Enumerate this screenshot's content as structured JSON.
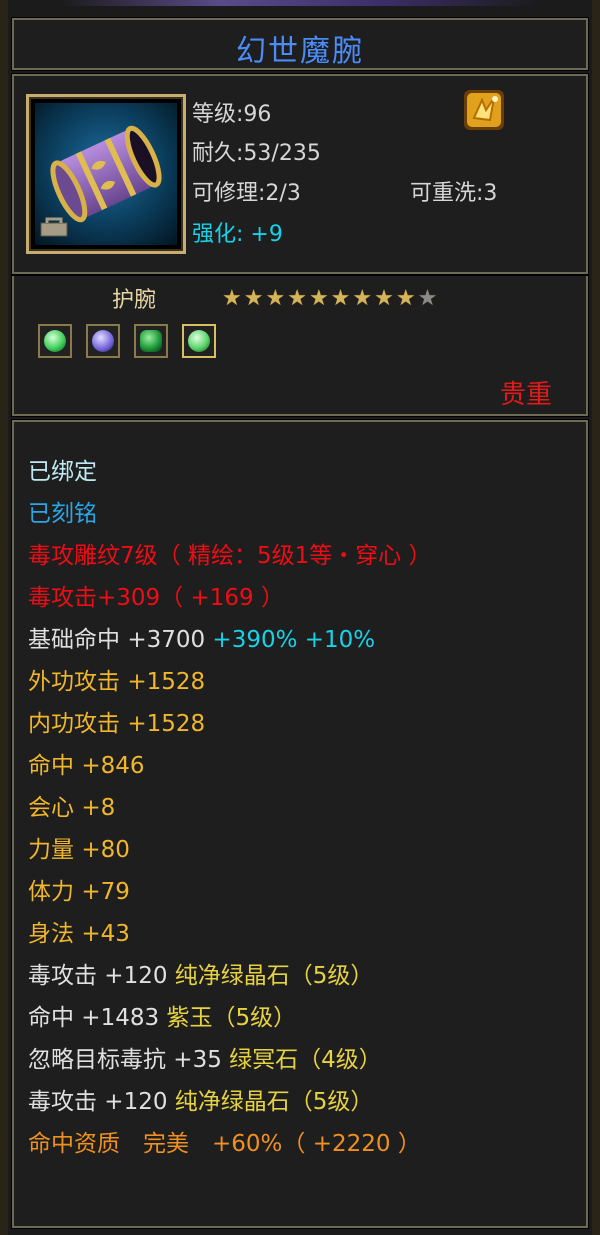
{
  "title": "幻世魔腕",
  "item": {
    "level_label": "等级:",
    "level": "96",
    "durability_label": "耐久:",
    "durability": "53/235",
    "repair_label": "可修理:",
    "repair": "2/3",
    "rewash_label": "可重洗:",
    "rewash": "3",
    "enhance_label": "强化:",
    "enhance": "+9",
    "icon": "purple-bracer-icon",
    "rune_icon": "gold-rune-icon"
  },
  "type_label": "护腕",
  "stars": {
    "filled": 9,
    "total": 10
  },
  "gems": [
    {
      "icon": "green-gem-icon",
      "color": "#3fcf5a"
    },
    {
      "icon": "purple-gem-icon",
      "color": "#7a6adf"
    },
    {
      "icon": "emerald-gem-icon",
      "color": "#1f9a3a"
    },
    {
      "icon": "green-gem-icon",
      "color": "#5ad46a"
    }
  ],
  "quality": "贵重",
  "attributes": {
    "bound": "已绑定",
    "engraved": "已刻铭",
    "carving": "毒攻雕纹7级（ 精绘：5级1等・穿心 ）",
    "carving_attack": "毒攻击+309（ +169 ）",
    "base_hit_name": "基础命中 ",
    "base_hit_value": "+3700",
    "base_hit_bonus": " +390% +10%",
    "external_attack_name": "外功攻击 ",
    "external_attack_value": "+1528",
    "internal_attack_name": "内功攻击 ",
    "internal_attack_value": "+1528",
    "hit_name": "命中 ",
    "hit_value": "+846",
    "crit_name": "会心 ",
    "crit_value": "+8",
    "strength_name": "力量 ",
    "strength_value": "+80",
    "stamina_name": "体力 ",
    "stamina_value": "+79",
    "agility_name": "身法 ",
    "agility_value": "+43",
    "gem1_stat": "毒攻击 +120 ",
    "gem1_name": "纯净绿晶石（5级）",
    "gem2_stat": "命中 +1483 ",
    "gem2_name": "紫玉（5级）",
    "gem3_stat": "忽略目标毒抗 +35 ",
    "gem3_name": "绿冥石（4级）",
    "gem4_stat": "毒攻击 +120 ",
    "gem4_name": "纯净绿晶石（5级）",
    "aptitude": "命中资质　完美　+60%（ +2220 ）"
  }
}
